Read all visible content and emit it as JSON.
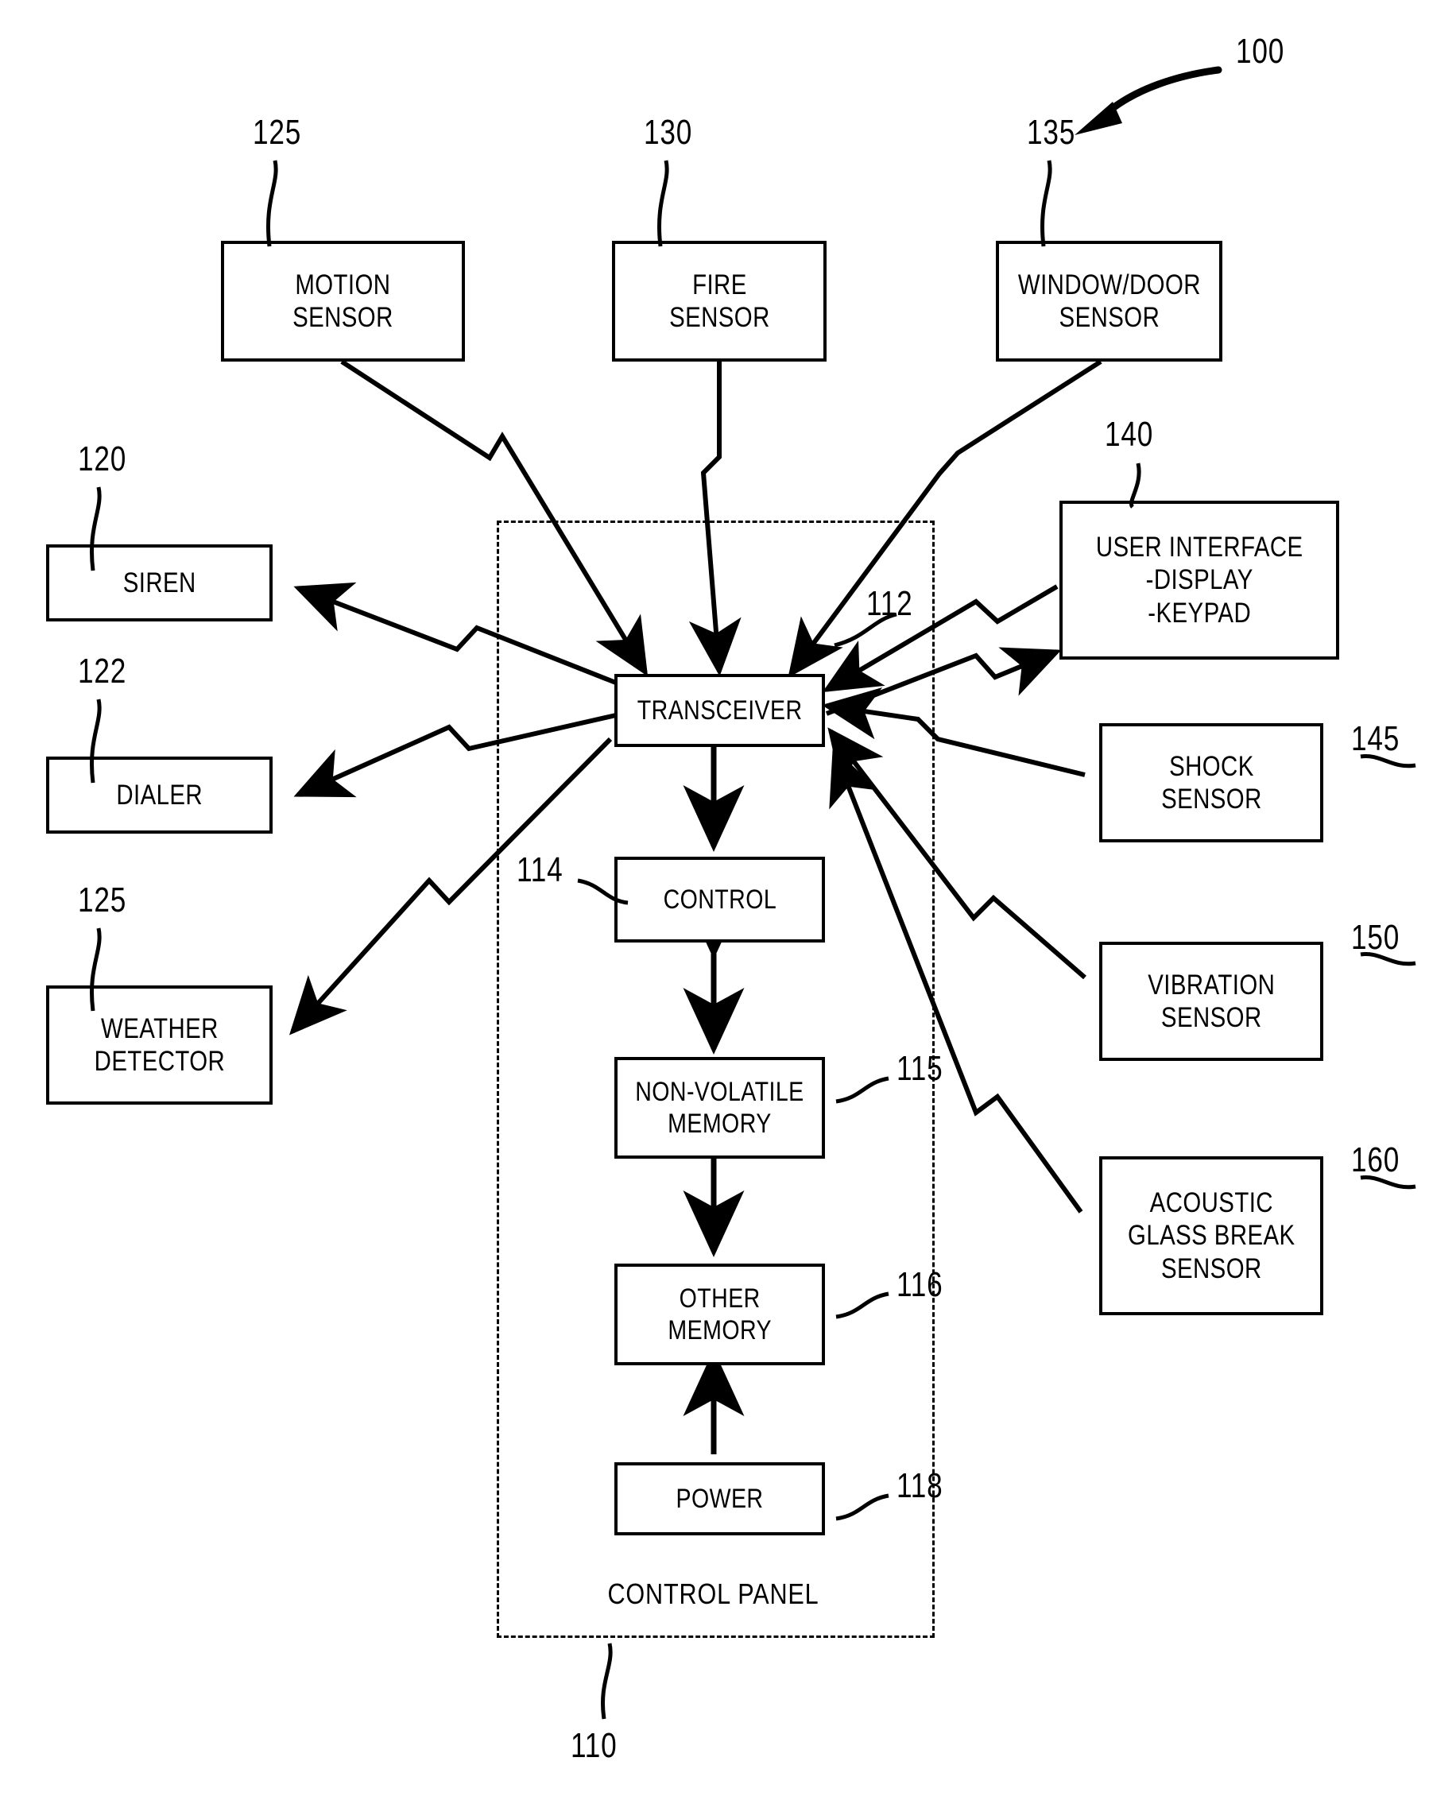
{
  "figure": {
    "figure_number": "100",
    "panel_caption": "CONTROL PANEL",
    "panel_ref": "110"
  },
  "external_nodes": [
    {
      "id": "motion-sensor",
      "label": "MOTION\nSENSOR",
      "ref": "125"
    },
    {
      "id": "fire-sensor",
      "label": "FIRE\nSENSOR",
      "ref": "130"
    },
    {
      "id": "window-door-sensor",
      "label": "WINDOW/DOOR\nSENSOR",
      "ref": "135"
    },
    {
      "id": "siren",
      "label": "SIREN",
      "ref": "120"
    },
    {
      "id": "dialer",
      "label": "DIALER",
      "ref": "122"
    },
    {
      "id": "weather-detector",
      "label": "WEATHER\nDETECTOR",
      "ref": "125"
    },
    {
      "id": "user-interface",
      "label": "USER INTERFACE\n-DISPLAY\n-KEYPAD",
      "ref": "140"
    },
    {
      "id": "shock-sensor",
      "label": "SHOCK\nSENSOR",
      "ref": "145"
    },
    {
      "id": "vibration-sensor",
      "label": "VIBRATION\nSENSOR",
      "ref": "150"
    },
    {
      "id": "acoustic-glass-break-sensor",
      "label": "ACOUSTIC\nGLASS BREAK\nSENSOR",
      "ref": "160"
    }
  ],
  "panel_nodes": [
    {
      "id": "transceiver",
      "label": "TRANSCEIVER",
      "ref": "112"
    },
    {
      "id": "control",
      "label": "CONTROL",
      "ref": "114"
    },
    {
      "id": "non-volatile-memory",
      "label": "NON-VOLATILE\nMEMORY",
      "ref": "115"
    },
    {
      "id": "other-memory",
      "label": "OTHER\nMEMORY",
      "ref": "116"
    },
    {
      "id": "power",
      "label": "POWER",
      "ref": "118"
    }
  ],
  "colors": {
    "line": "#000000",
    "background": "#ffffff"
  }
}
